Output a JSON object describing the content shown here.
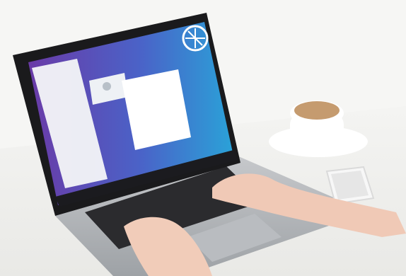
{
  "scene": {
    "description_labels": {
      "photo": "laptop-desk-photo"
    }
  },
  "screen": {
    "background_gradient": [
      "#6a3aa7",
      "#3f6fcf",
      "#2aa2d8"
    ],
    "taskbar_color": "#1b1b1f",
    "logo": "circular-logo"
  },
  "desk": {
    "table_color": "#f3f3f1",
    "cup_color": "#ffffff",
    "coffee_color": "#c59b6f",
    "phone_color": "#f7f7f7"
  }
}
